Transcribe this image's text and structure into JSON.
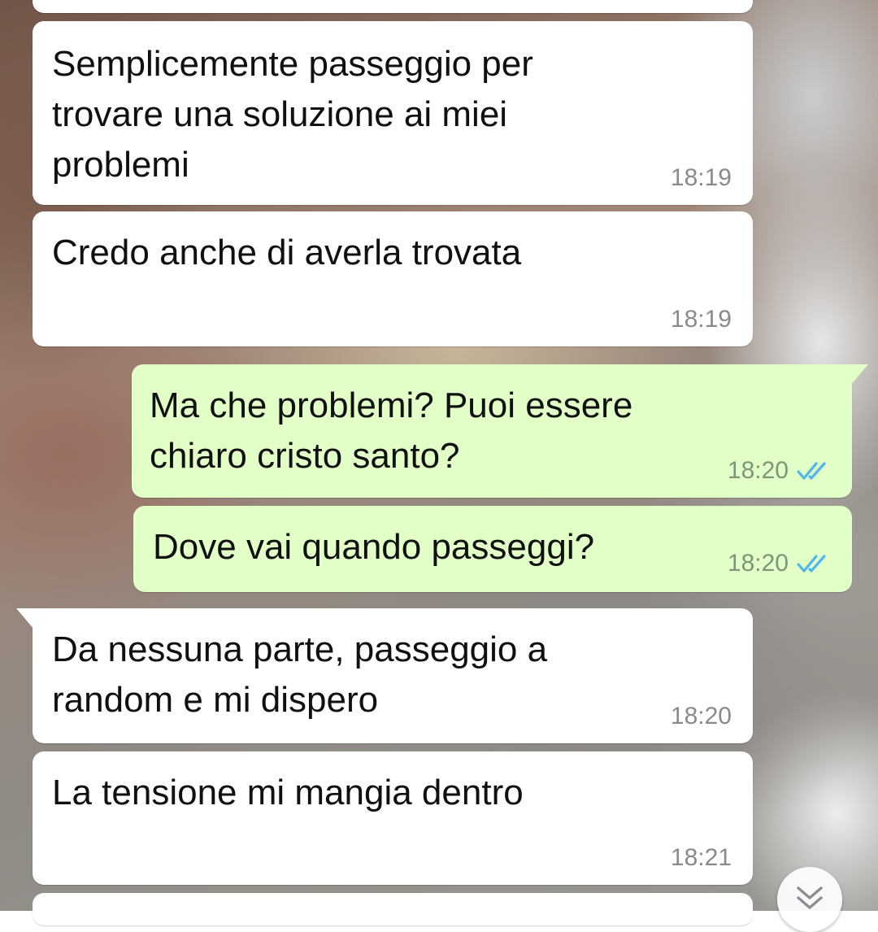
{
  "chat": {
    "messages": [
      {
        "direction": "incoming",
        "text": "Semplicemente passeggio per trovare una soluzione ai miei problemi",
        "time": "18:19"
      },
      {
        "direction": "incoming",
        "text": "Credo anche di averla trovata",
        "time": "18:19"
      },
      {
        "direction": "outgoing",
        "text": "Ma che problemi? Puoi essere chiaro cristo santo?",
        "time": "18:20",
        "status": "read"
      },
      {
        "direction": "outgoing",
        "text": "Dove vai quando passeggi?",
        "time": "18:20",
        "status": "read"
      },
      {
        "direction": "incoming",
        "text": "Da nessuna parte, passeggio a random e mi dispero",
        "time": "18:20"
      },
      {
        "direction": "incoming",
        "text": "La tensione mi mangia dentro",
        "time": "18:21"
      }
    ],
    "read_tick_color": "#4fb6ec",
    "scroll_button_icon": "chevron-double-down-icon"
  }
}
